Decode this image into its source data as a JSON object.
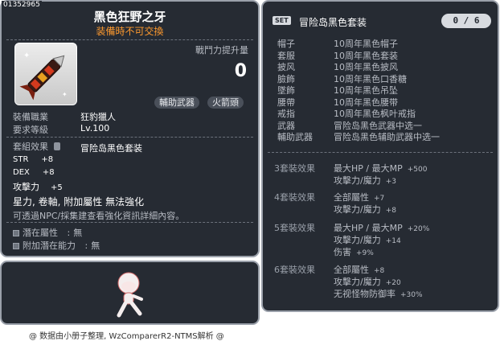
{
  "item_id": "01352965",
  "item": {
    "name": "黑色狂野之牙",
    "untradeable": "装備時不可交換",
    "power_label": "戰鬥力提升量",
    "power_value": "0",
    "tag_secondary": "輔助武器",
    "tag_arrowhead": "火箭頭",
    "job_label": "裝備職業",
    "job_value": "狂豹獵人",
    "level_label": "要求等級",
    "level_value": "Lv.100",
    "set_label": "套組效果",
    "set_value": "冒险岛黑色套装",
    "stats": [
      {
        "name": "STR",
        "value": "+8"
      },
      {
        "name": "DEX",
        "value": "+8"
      },
      {
        "name": "攻擊力",
        "value": "+5"
      }
    ],
    "restrictions": "星力, 卷軸, 附加屬性 無法強化",
    "hint": "可透過NPC/採集建查看強化資訊詳細內容。",
    "potential_label": "潛在屬性",
    "potential_value": "無",
    "bonus_potential_label": "附加潛在能力",
    "bonus_potential_value": "無"
  },
  "set": {
    "badge": "SET",
    "title": "冒险岛黑色套装",
    "count": "0 / 6",
    "pieces": [
      {
        "slot": "帽子",
        "name": "10周年黑色帽子"
      },
      {
        "slot": "套服",
        "name": "10周年黑色套装"
      },
      {
        "slot": "披风",
        "name": "10周年黑色披风"
      },
      {
        "slot": "臉飾",
        "name": "10周年黑色口香糖"
      },
      {
        "slot": "墜飾",
        "name": "10周年黑色吊坠"
      },
      {
        "slot": "腰帶",
        "name": "10周年黑色腰带"
      },
      {
        "slot": "戒指",
        "name": "10周年黑色枫叶戒指"
      },
      {
        "slot": "武器",
        "name": "冒险岛黑色武器中选一"
      },
      {
        "slot": "輔助武器",
        "name": "冒险岛黑色辅助武器中选一"
      }
    ],
    "bonuses": [
      {
        "label": "3套裝效果",
        "lines": [
          {
            "text": "最大HP / 最大MP",
            "num": "+500"
          },
          {
            "text": "攻擊力/魔力",
            "num": "+3"
          }
        ]
      },
      {
        "label": "4套裝效果",
        "lines": [
          {
            "text": "全部屬性",
            "num": "+7"
          },
          {
            "text": "攻擊力/魔力",
            "num": "+8"
          }
        ]
      },
      {
        "label": "5套裝效果",
        "lines": [
          {
            "text": "最大HP / 最大MP",
            "num": "+20%"
          },
          {
            "text": "攻擊力/魔力",
            "num": "+14"
          },
          {
            "text": "伤害",
            "num": "+9%"
          }
        ]
      },
      {
        "label": "6套裝效果",
        "lines": [
          {
            "text": "全部屬性",
            "num": "+8"
          },
          {
            "text": "攻擊力/魔力",
            "num": "+20"
          },
          {
            "text": "无视怪物防御率",
            "num": "+30%"
          }
        ]
      }
    ]
  },
  "footer": "@ 数据由小册子整理, WzComparerR2-NTMS解析 @",
  "colors": {
    "panel": "#262b33",
    "accent_orange": "#ff9a2e",
    "muted": "#b8bcc4"
  }
}
